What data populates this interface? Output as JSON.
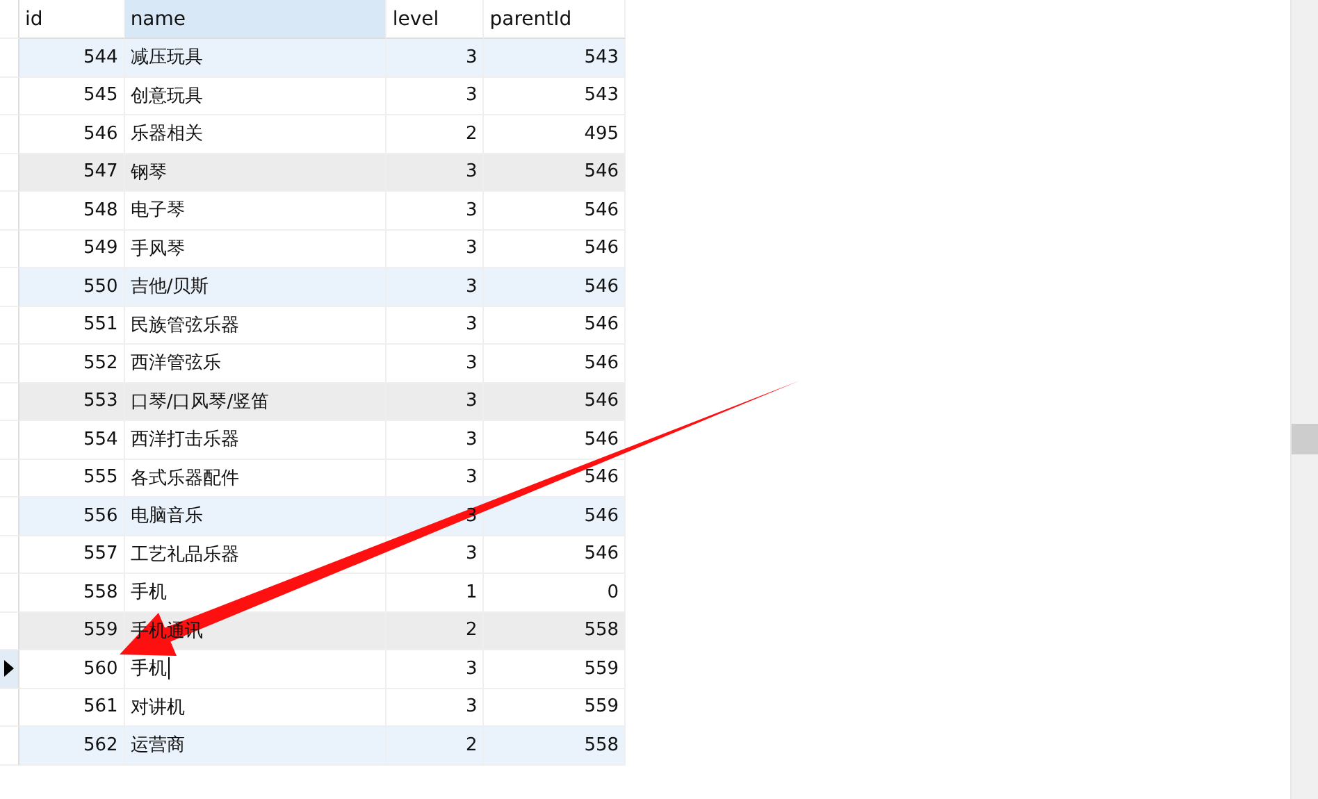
{
  "table": {
    "columns": [
      "id",
      "name",
      "level",
      "parentId"
    ],
    "rows": [
      {
        "cells": [
          "544",
          "减压玩具",
          "3",
          "543"
        ],
        "color": "#eaf3fc",
        "current": false,
        "editing": false
      },
      {
        "cells": [
          "545",
          "创意玩具",
          "3",
          "543"
        ],
        "color": "#ffffff",
        "current": false,
        "editing": false
      },
      {
        "cells": [
          "546",
          "乐器相关",
          "2",
          "495"
        ],
        "color": "#ffffff",
        "current": false,
        "editing": false
      },
      {
        "cells": [
          "547",
          "钢琴",
          "3",
          "546"
        ],
        "color": "#ececec",
        "current": false,
        "editing": false
      },
      {
        "cells": [
          "548",
          "电子琴",
          "3",
          "546"
        ],
        "color": "#ffffff",
        "current": false,
        "editing": false
      },
      {
        "cells": [
          "549",
          "手风琴",
          "3",
          "546"
        ],
        "color": "#ffffff",
        "current": false,
        "editing": false
      },
      {
        "cells": [
          "550",
          "吉他/贝斯",
          "3",
          "546"
        ],
        "color": "#eaf3fc",
        "current": false,
        "editing": false
      },
      {
        "cells": [
          "551",
          "民族管弦乐器",
          "3",
          "546"
        ],
        "color": "#ffffff",
        "current": false,
        "editing": false
      },
      {
        "cells": [
          "552",
          "西洋管弦乐",
          "3",
          "546"
        ],
        "color": "#ffffff",
        "current": false,
        "editing": false
      },
      {
        "cells": [
          "553",
          "口琴/口风琴/竖笛",
          "3",
          "546"
        ],
        "color": "#ececec",
        "current": false,
        "editing": false
      },
      {
        "cells": [
          "554",
          "西洋打击乐器",
          "3",
          "546"
        ],
        "color": "#ffffff",
        "current": false,
        "editing": false
      },
      {
        "cells": [
          "555",
          "各式乐器配件",
          "3",
          "546"
        ],
        "color": "#ffffff",
        "current": false,
        "editing": false
      },
      {
        "cells": [
          "556",
          "电脑音乐",
          "3",
          "546"
        ],
        "color": "#eaf3fc",
        "current": false,
        "editing": false
      },
      {
        "cells": [
          "557",
          "工艺礼品乐器",
          "3",
          "546"
        ],
        "color": "#ffffff",
        "current": false,
        "editing": false
      },
      {
        "cells": [
          "558",
          "手机",
          "1",
          "0"
        ],
        "color": "#ffffff",
        "current": false,
        "editing": false
      },
      {
        "cells": [
          "559",
          "手机通讯",
          "2",
          "558"
        ],
        "color": "#ececec",
        "current": false,
        "editing": false
      },
      {
        "cells": [
          "560",
          "手机",
          "3",
          "559"
        ],
        "color": "#ffffff",
        "current": true,
        "editing": true
      },
      {
        "cells": [
          "561",
          "对讲机",
          "3",
          "559"
        ],
        "color": "#ffffff",
        "current": false,
        "editing": false
      },
      {
        "cells": [
          "562",
          "运营商",
          "2",
          "558"
        ],
        "color": "#eaf3fc",
        "current": false,
        "editing": false
      }
    ]
  }
}
